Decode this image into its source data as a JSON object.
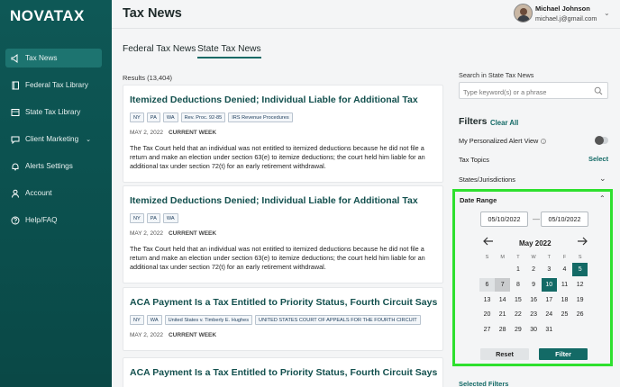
{
  "app": {
    "logo": "NOVATAX"
  },
  "sidebar": {
    "items": [
      {
        "label": "Tax News",
        "icon": "megaphone-icon",
        "active": true
      },
      {
        "label": "Federal Tax Library",
        "icon": "book-icon"
      },
      {
        "label": "State Tax Library",
        "icon": "library-icon"
      },
      {
        "label": "Client Marketing",
        "icon": "chat-icon",
        "caret": "⌄"
      },
      {
        "label": "Alerts Settings",
        "icon": "bell-icon"
      },
      {
        "label": "Account",
        "icon": "user-icon"
      },
      {
        "label": "Help/FAQ",
        "icon": "help-icon"
      }
    ]
  },
  "header": {
    "title": "Tax News",
    "user": {
      "name": "Michael Johnson",
      "email": "michael.j@gmail.com"
    }
  },
  "tabs": [
    {
      "label": "Federal Tax News",
      "active": false
    },
    {
      "label": "State Tax News",
      "active": true
    }
  ],
  "results": {
    "label": "Results (13,404)"
  },
  "articles": [
    {
      "title": "Itemized Deductions Denied; Individual Liable for Additional Tax",
      "tags": [
        "NY",
        "PA",
        "WA",
        "Rev. Proc. 92-85",
        "IRS Revenue Procedures"
      ],
      "date": "MAY 2, 2022",
      "badge": "CURRENT WEEK",
      "body": "The Tax Court held that an individual was not entitled to itemized deductions because he did not file a return and make an election under section 63(e) to itemize deductions; the court held him liable for an additional tax under section 72(t) for an early retirement withdrawal."
    },
    {
      "title": "Itemized Deductions Denied; Individual Liable for Additional Tax",
      "tags": [
        "NY",
        "PA",
        "WA"
      ],
      "date": "MAY 2, 2022",
      "badge": "CURRENT WEEK",
      "body": "The Tax Court held that an individual was not entitled to itemized deductions because he did not file a return and make an election under section 63(e) to itemize deductions; the court held him liable for an additional tax under section 72(t) for an early retirement withdrawal."
    },
    {
      "title": "ACA Payment Is a Tax Entitled to Priority Status, Fourth Circuit Says",
      "tags": [
        "NY",
        "WA",
        "United States v. Timberly E. Hughes",
        "UNITED STATES COURT OF APPEALS FOR THE FOURTH CIRCUIT"
      ],
      "date": "MAY 2, 2022",
      "badge": "CURRENT WEEK",
      "body": ""
    },
    {
      "title": "ACA Payment Is a Tax Entitled to Priority Status, Fourth Circuit Says",
      "tags": [],
      "date": "",
      "badge": "",
      "body": ""
    }
  ],
  "search": {
    "label": "Search in State Tax News",
    "placeholder": "Type keyword(s) or a phrase"
  },
  "filters": {
    "title": "Filters",
    "clear_all": "Clear All",
    "alert_view": "My Personalized Alert View",
    "alert_view_on": false,
    "tax_topics": "Tax Topics",
    "select": "Select",
    "states": "States/Jurisdictions",
    "date_range": {
      "label": "Date Range",
      "from": "05/10/2022",
      "to": "05/10/2022",
      "month": "May 2022",
      "weekdays": [
        "S",
        "M",
        "T",
        "W",
        "T",
        "F",
        "S"
      ],
      "weeks": [
        [
          "",
          "",
          "1",
          "2",
          "3",
          "4",
          "5"
        ],
        [
          "6",
          "7",
          "8",
          "9",
          "10",
          "11",
          "12"
        ],
        [
          "13",
          "14",
          "15",
          "16",
          "17",
          "18",
          "19"
        ],
        [
          "20",
          "21",
          "22",
          "23",
          "24",
          "25",
          "26"
        ],
        [
          "27",
          "28",
          "29",
          "30",
          "31",
          "",
          ""
        ]
      ],
      "selected_day": "10",
      "highlight_days": [
        "5",
        "6",
        "7"
      ],
      "today_day": "7",
      "reset": "Reset",
      "filter": "Filter"
    },
    "selected_filters": "Selected Filters"
  },
  "colors": {
    "brand": "#136a66",
    "sidebar": "#0e5856",
    "highlight_border": "#2ee02e"
  }
}
